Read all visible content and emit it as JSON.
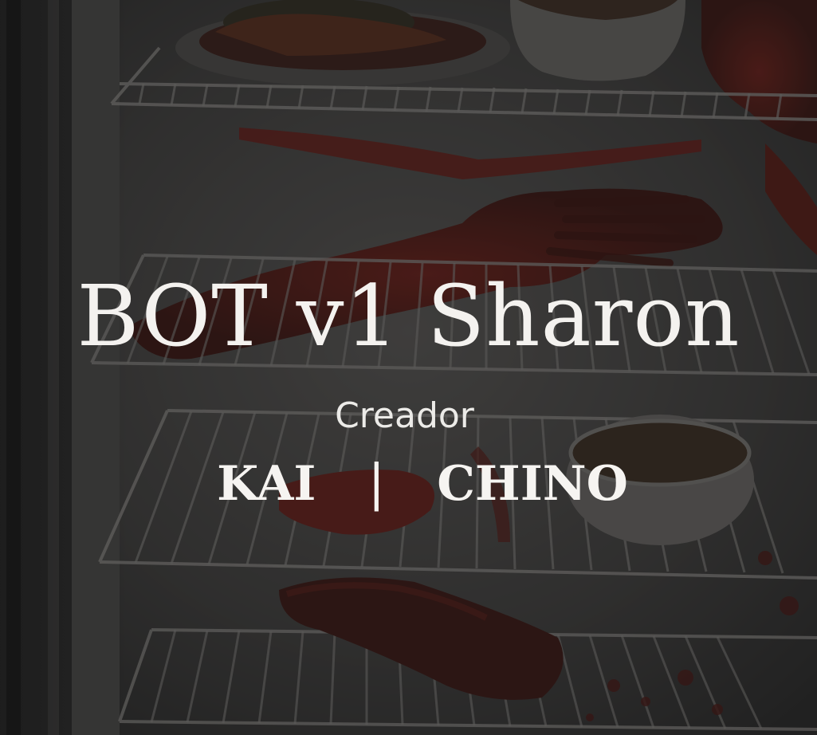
{
  "banner": {
    "title": "BOT v1 Sharon",
    "creator_label": "Creador",
    "creators": [
      "KAI",
      "CHINO"
    ],
    "separator": "|"
  },
  "colors": {
    "overlay": "#2a2a2c",
    "text": "#f4f2ef",
    "blood_dark": "#4a1410",
    "blood": "#7a1e18",
    "shelf_wire": "#8b8a88"
  },
  "photo": {
    "subject": "refrigerator-interior-with-wire-shelves"
  }
}
